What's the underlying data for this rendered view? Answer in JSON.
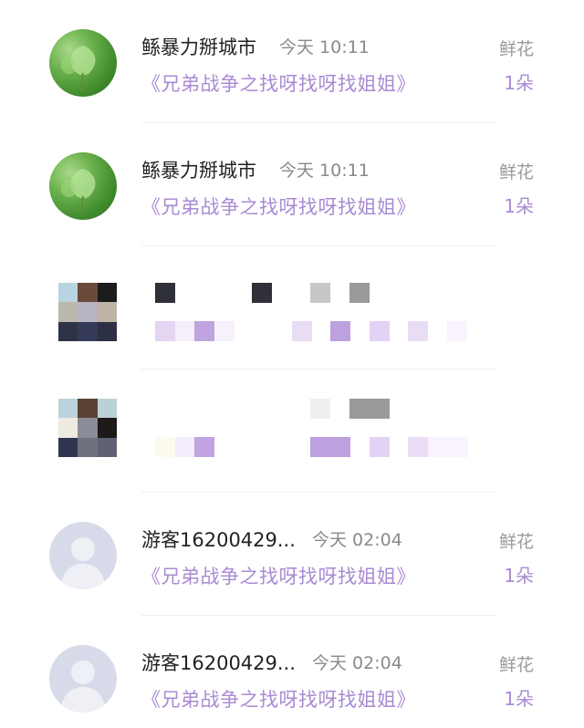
{
  "rows": [
    {
      "name": "鲧暴力掰城市",
      "time": "今天 10:11",
      "book": "《兄弟战争之找呀找呀找姐姐》",
      "gift_label": "鲜花",
      "gift_count": "1朵",
      "avatar": "leaf-avatar"
    },
    {
      "name": "鲧暴力掰城市",
      "time": "今天 10:11",
      "book": "《兄弟战争之找呀找呀找姐姐》",
      "gift_label": "鲜花",
      "gift_count": "1朵",
      "avatar": "leaf-avatar"
    },
    {
      "name": "",
      "time": "",
      "book": "",
      "gift_label": "",
      "gift_count": "",
      "avatar": "pixelated-avatar"
    },
    {
      "name": "",
      "time": "",
      "book": "",
      "gift_label": "",
      "gift_count": "",
      "avatar": "pixelated-avatar"
    },
    {
      "name": "游客16200429...",
      "time": "今天 02:04",
      "book": "《兄弟战争之找呀找呀找姐姐》",
      "gift_label": "鲜花",
      "gift_count": "1朵",
      "avatar": "default-person-avatar"
    },
    {
      "name": "游客16200429...",
      "time": "今天 02:04",
      "book": "《兄弟战争之找呀找呀找姐姐》",
      "gift_label": "鲜花",
      "gift_count": "1朵",
      "avatar": "default-person-avatar"
    }
  ],
  "colors": {
    "accent_purple": "#a98bd3",
    "name_text": "#222222",
    "meta_text": "#8a8a8a",
    "avatar_default_bg": "#d7dbe9"
  }
}
